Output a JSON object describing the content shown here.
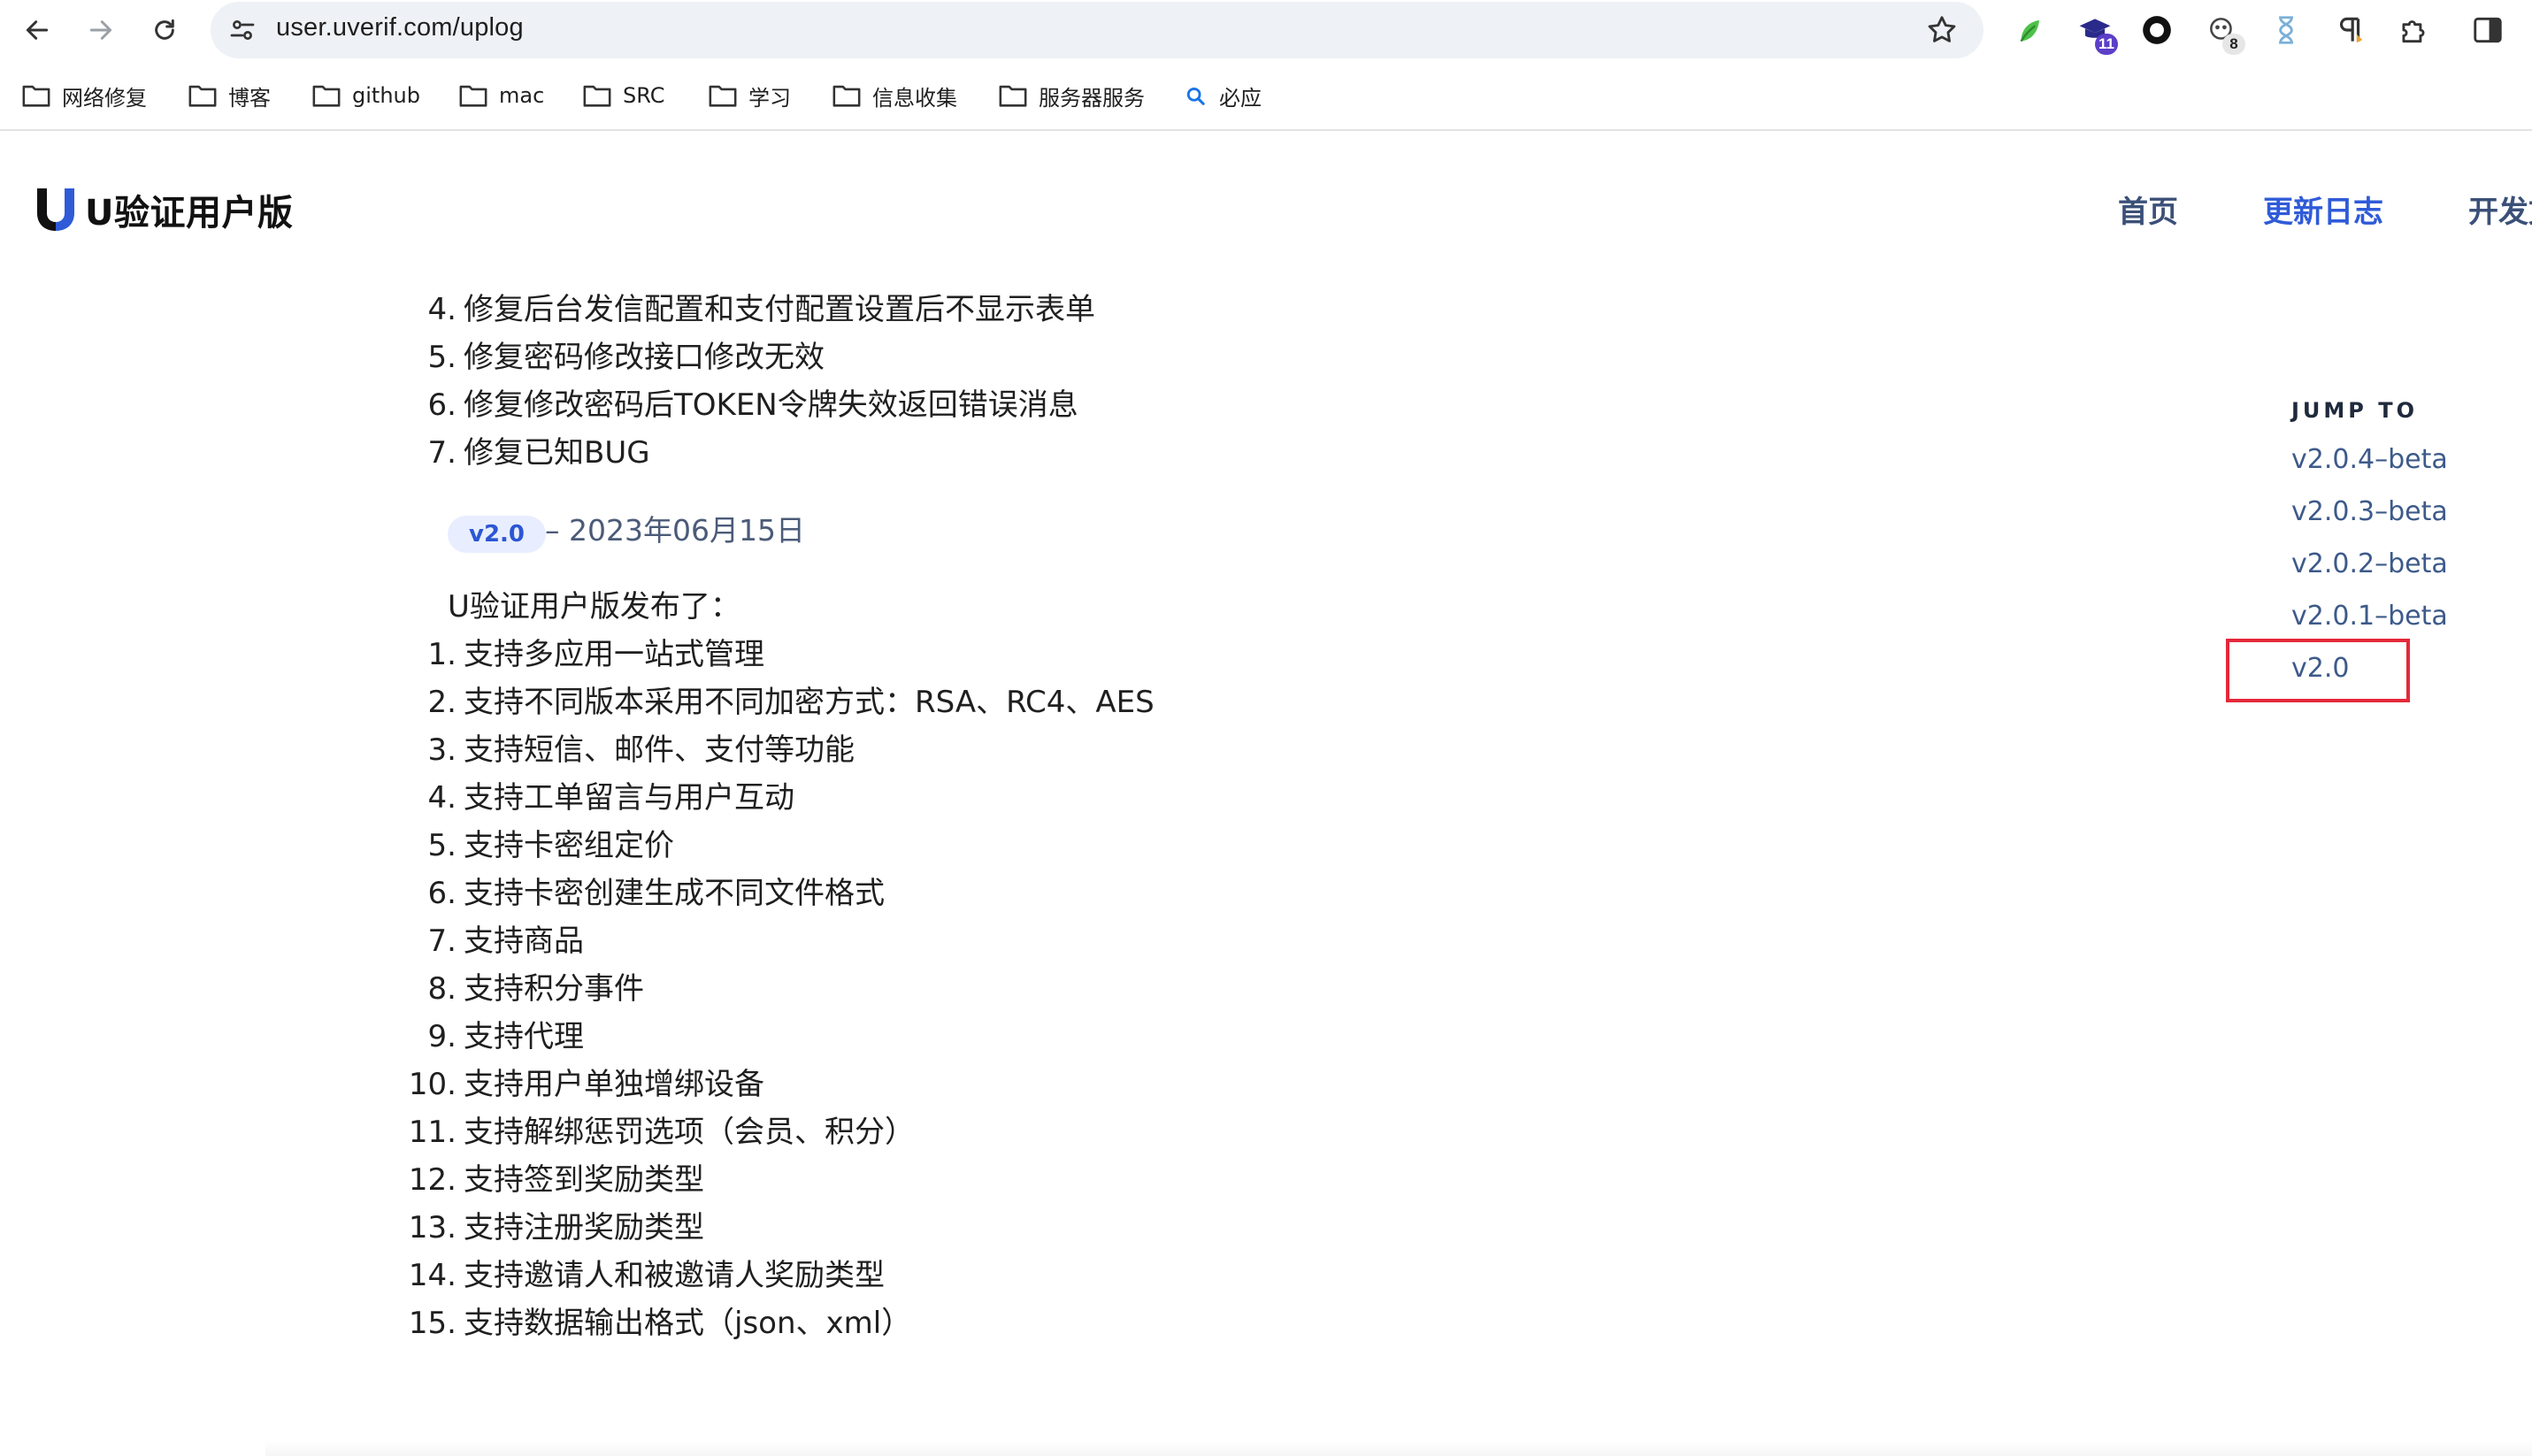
{
  "browser": {
    "url": "user.uverif.com/uplog",
    "extensions": [
      {
        "name": "leaf-extension"
      },
      {
        "name": "graduation-cap-extension",
        "badge": "11"
      },
      {
        "name": "circle-record-extension"
      },
      {
        "name": "panda-extension",
        "badge": "8"
      },
      {
        "name": "hourglass-extension"
      },
      {
        "name": "pilcrow-extension"
      },
      {
        "name": "puzzle-extension"
      },
      {
        "name": "side-panel"
      }
    ],
    "bookmarks": [
      {
        "label": "网络修复",
        "icon": "folder-icon"
      },
      {
        "label": "博客",
        "icon": "folder-icon"
      },
      {
        "label": "github",
        "icon": "folder-icon"
      },
      {
        "label": "mac",
        "icon": "folder-icon"
      },
      {
        "label": "SRC",
        "icon": "folder-icon"
      },
      {
        "label": "学习",
        "icon": "folder-icon"
      },
      {
        "label": "信息收集",
        "icon": "folder-icon"
      },
      {
        "label": "服务器服务",
        "icon": "folder-icon"
      },
      {
        "label": "必应",
        "icon": "search-icon"
      }
    ]
  },
  "site": {
    "logo_text": "U验证用户版",
    "nav": [
      {
        "label": "首页",
        "active": false
      },
      {
        "label": "更新日志",
        "active": true
      },
      {
        "label": "开发文档",
        "active": false
      }
    ]
  },
  "changelog": {
    "previous_items": [
      {
        "num": "4.",
        "text": "修复后台发信配置和支付配置设置后不显示表单"
      },
      {
        "num": "5.",
        "text": "修复密码修改接口修改无效"
      },
      {
        "num": "6.",
        "text": "修复修改密码后TOKEN令牌失效返回错误消息"
      },
      {
        "num": "7.",
        "text": "修复已知BUG"
      }
    ],
    "version_tag": "v2.0",
    "version_date": "– 2023年06月15日",
    "release_intro": "U验证用户版发布了：",
    "release_items": [
      {
        "num": "1.",
        "text": "支持多应用一站式管理"
      },
      {
        "num": "2.",
        "text": "支持不同版本采用不同加密方式：RSA、RC4、AES"
      },
      {
        "num": "3.",
        "text": "支持短信、邮件、支付等功能"
      },
      {
        "num": "4.",
        "text": "支持工单留言与用户互动"
      },
      {
        "num": "5.",
        "text": "支持卡密组定价"
      },
      {
        "num": "6.",
        "text": "支持卡密创建生成不同文件格式"
      },
      {
        "num": "7.",
        "text": "支持商品"
      },
      {
        "num": "8.",
        "text": "支持积分事件"
      },
      {
        "num": "9.",
        "text": "支持代理"
      },
      {
        "num": "10.",
        "text": "支持用户单独增绑设备"
      },
      {
        "num": "11.",
        "text": "支持解绑惩罚选项（会员、积分）"
      },
      {
        "num": "12.",
        "text": "支持签到奖励类型"
      },
      {
        "num": "13.",
        "text": "支持注册奖励类型"
      },
      {
        "num": "14.",
        "text": "支持邀请人和被邀请人奖励类型"
      },
      {
        "num": "15.",
        "text": "支持数据输出格式（json、xml）"
      }
    ]
  },
  "toc": {
    "title": "JUMP TO",
    "links": [
      "v2.0.4–beta",
      "v2.0.3–beta",
      "v2.0.2–beta",
      "v2.0.1–beta",
      "v2.0"
    ],
    "highlighted": "v2.0"
  },
  "colors": {
    "accent": "#2f5bd8",
    "nav_text": "#3b5078",
    "highlight_box": "#e5283a",
    "tag_background": "#e8eeff"
  }
}
